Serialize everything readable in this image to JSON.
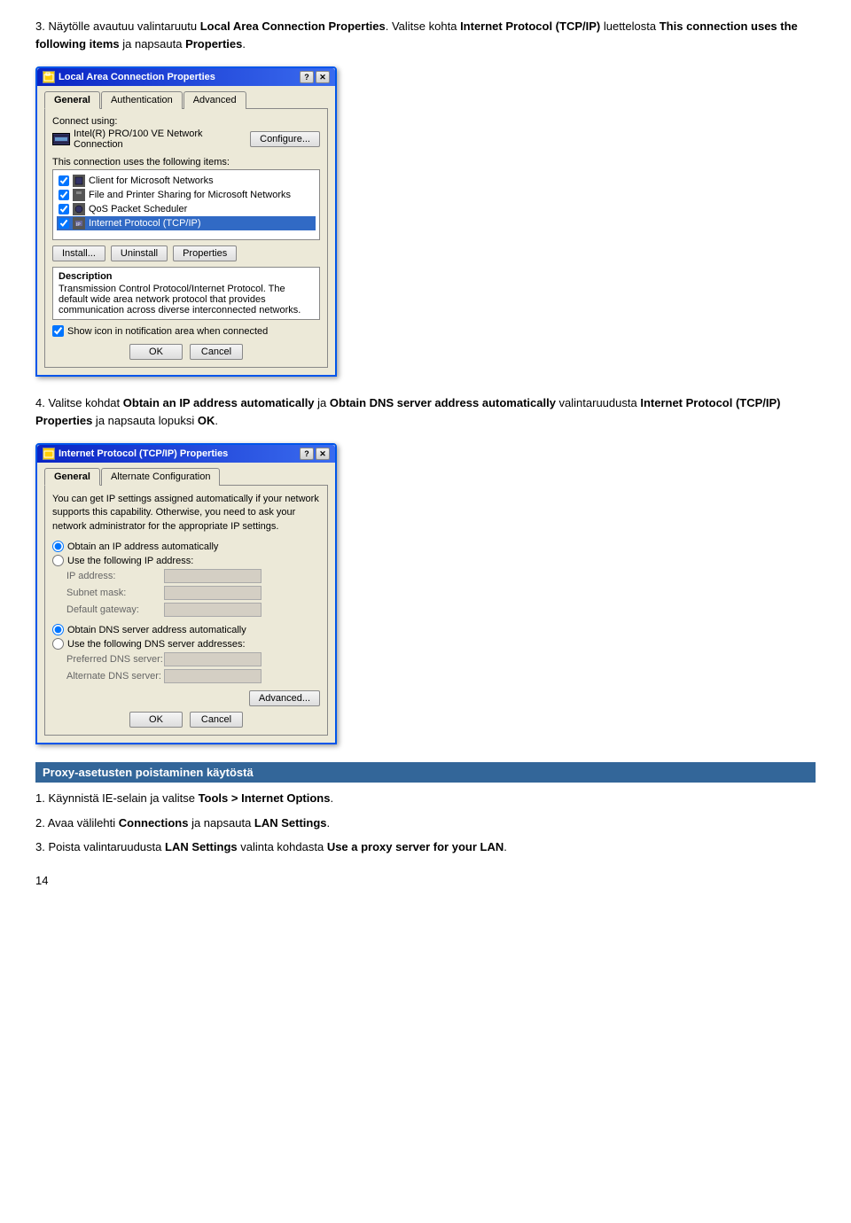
{
  "step3": {
    "text": "3. Näytölle avautuu valintaruutu ",
    "bold1": "Local Area Connection Properties",
    "text2": ". Valitse kohta ",
    "bold2": "Internet Protocol (TCP/IP)",
    "text3": " luettelosta ",
    "bold3": "This connection uses the following items",
    "text4": " ja napsauta ",
    "bold4": "Properties",
    "text5": "."
  },
  "dialog1": {
    "title": "Local Area Connection Properties",
    "title_icon": "⊞",
    "tabs": [
      "General",
      "Authentication",
      "Advanced"
    ],
    "active_tab": "General",
    "connect_using_label": "Connect using:",
    "device_name": "Intel(R) PRO/100 VE Network Connection",
    "configure_btn": "Configure...",
    "items_label": "This connection uses the following items:",
    "items": [
      {
        "label": "Client for Microsoft Networks",
        "checked": true,
        "selected": false
      },
      {
        "label": "File and Printer Sharing for Microsoft Networks",
        "checked": true,
        "selected": false
      },
      {
        "label": "QoS Packet Scheduler",
        "checked": true,
        "selected": false
      },
      {
        "label": "Internet Protocol (TCP/IP)",
        "checked": true,
        "selected": true
      }
    ],
    "install_btn": "Install...",
    "uninstall_btn": "Uninstall",
    "properties_btn": "Properties",
    "description_title": "Description",
    "description_text": "Transmission Control Protocol/Internet Protocol. The default wide area network protocol that provides communication across diverse interconnected networks.",
    "show_icon_label": "Show icon in notification area when connected",
    "ok_btn": "OK",
    "cancel_btn": "Cancel"
  },
  "step4": {
    "text": "4. Valitse kohdat ",
    "bold1": "Obtain an IP address automatically",
    "text2": " ja ",
    "bold2": "Obtain DNS server address automatically",
    "text3": " valintaruudusta ",
    "bold3": "Internet Protocol (TCP/IP) Properties",
    "text4": " ja napsauta lopuksi ",
    "bold4": "OK",
    "text5": "."
  },
  "dialog2": {
    "title": "Internet Protocol (TCP/IP) Properties",
    "title_icon": "⊞",
    "tabs": [
      "General",
      "Alternate Configuration"
    ],
    "active_tab": "General",
    "info_text": "You can get IP settings assigned automatically if your network supports this capability. Otherwise, you need to ask your network administrator for the appropriate IP settings.",
    "radio_obtain_ip": "Obtain an IP address automatically",
    "radio_use_ip": "Use the following IP address:",
    "ip_address_label": "IP address:",
    "subnet_mask_label": "Subnet mask:",
    "default_gateway_label": "Default gateway:",
    "radio_obtain_dns": "Obtain DNS server address automatically",
    "radio_use_dns": "Use the following DNS server addresses:",
    "preferred_dns_label": "Preferred DNS server:",
    "alternate_dns_label": "Alternate DNS server:",
    "advanced_btn": "Advanced...",
    "ok_btn": "OK",
    "cancel_btn": "Cancel"
  },
  "proxy_section": {
    "heading": "Proxy-asetusten poistaminen käytöstä",
    "steps": [
      {
        "num": "1.",
        "text": "Käynnistä IE-selain ja valitse ",
        "bold": "Tools > Internet Options",
        "end": "."
      },
      {
        "num": "2.",
        "text": "Avaa välilehti ",
        "bold": "Connections",
        "end": " ja napsauta ",
        "bold2": "LAN Settings",
        "end2": "."
      },
      {
        "num": "3.",
        "text": "Poista valintaruudusta ",
        "bold": "LAN Settings",
        "end": " valinta kohdasta ",
        "bold2": "Use a proxy server for your LAN",
        "end2": "."
      }
    ]
  },
  "page_num": "14"
}
